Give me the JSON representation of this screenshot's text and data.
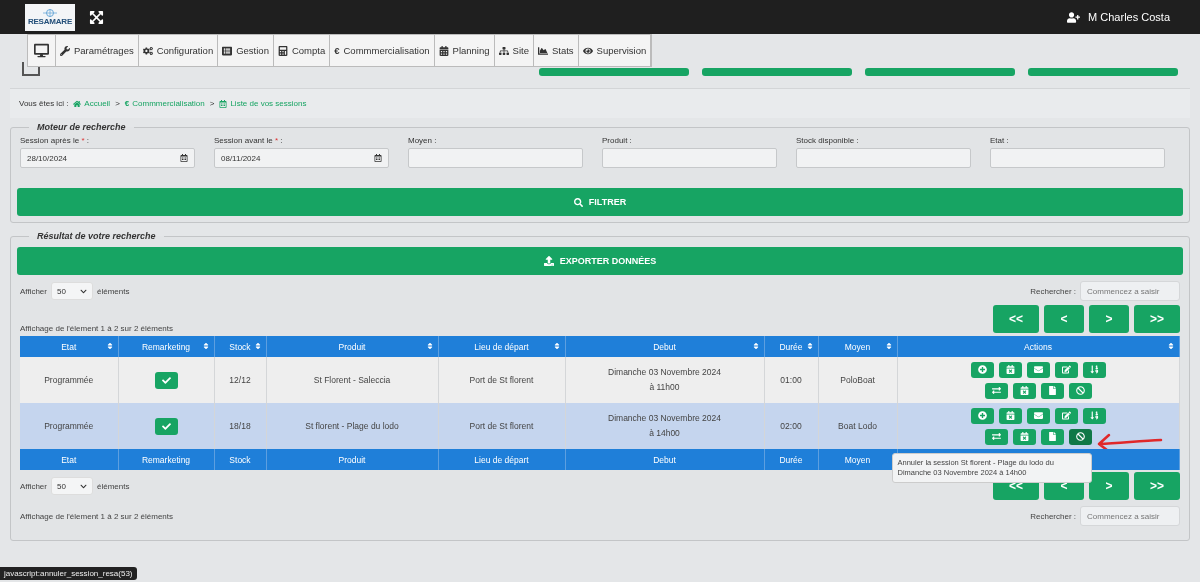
{
  "header": {
    "logo": "RESAMARE",
    "user": "M Charles Costa"
  },
  "menu": [
    {
      "label": "Paramétrages"
    },
    {
      "label": "Configuration"
    },
    {
      "label": "Gestion"
    },
    {
      "label": "Compta"
    },
    {
      "symbol": "€",
      "label": "Commmercialisation"
    },
    {
      "label": "Planning"
    },
    {
      "label": "Site"
    },
    {
      "label": "Stats"
    },
    {
      "label": "Supervision"
    }
  ],
  "breadcrumb": {
    "prefix": "Vous êtes ici :",
    "items": [
      {
        "label": "Accueil"
      },
      {
        "symbol": "€",
        "label": "Commmercialisation"
      },
      {
        "label": "Liste de vos sessions"
      }
    ],
    "separators": [
      ">",
      ">"
    ]
  },
  "search": {
    "legend": "Moteur de recherche",
    "fields": [
      {
        "label": "Session après le",
        "required_mark": "*",
        "label_end": ":",
        "kind": "date",
        "value": "28/10/2024"
      },
      {
        "label": "Session avant le",
        "required_mark": "*",
        "label_end": ":",
        "kind": "date",
        "value": "08/11/2024"
      },
      {
        "label": "Moyen :",
        "kind": "text"
      },
      {
        "label": "Produit :",
        "kind": "text"
      },
      {
        "label": "Stock disponible :",
        "kind": "text"
      },
      {
        "label": "Etat :",
        "kind": "text"
      }
    ],
    "button": "FILTRER"
  },
  "results": {
    "legend": "Résultat de votre recherche",
    "export_button": "EXPORTER DONNÉES",
    "top": {
      "length": {
        "before": "Afficher",
        "value": "50",
        "after": "éléments"
      },
      "search_label": "Rechercher :",
      "search_placeholder": "Commencez a saisir",
      "info": "Affichage de l'élement 1 à 2 sur 2 éléments",
      "pagination": [
        "<<",
        "<",
        ">",
        ">>"
      ]
    },
    "bottom": {
      "length": {
        "before": "Afficher",
        "value": "50",
        "after": "éléments"
      },
      "search_label": "Rechercher :",
      "search_placeholder": "Commencez a saisir",
      "info": "Affichage de l'élement 1 à 2 sur 2 éléments",
      "pagination": [
        "<<",
        "<",
        ">",
        ">>"
      ]
    }
  },
  "table": {
    "columns": [
      "Etat",
      "Remarketing",
      "Stock",
      "Produit",
      "Lieu de départ",
      "Debut",
      "Durée",
      "Moyen",
      "Actions"
    ],
    "rows": [
      {
        "selected": false,
        "etat": "Programmée",
        "remarketing": true,
        "stock": "12/12",
        "produit": "St Florent - Saleccia",
        "lieu": "Port de St florent",
        "debut": [
          "Dimanche 03 Novembre 2024",
          "à 11h00"
        ],
        "duree": "01:00",
        "moyen": "PoloBoat",
        "actions": [
          {
            "hovered": false
          },
          {
            "hovered": false
          },
          {
            "hovered": false
          },
          {
            "hovered": false
          },
          {
            "hovered": false
          },
          {
            "hovered": false
          },
          {
            "hovered": false
          },
          {
            "hovered": false
          },
          {
            "hovered": false
          }
        ]
      },
      {
        "selected": true,
        "etat": "Programmée",
        "remarketing": true,
        "stock": "18/18",
        "produit": "St florent - Plage du lodo",
        "lieu": "Port de St florent",
        "debut": [
          "Dimanche 03 Novembre 2024",
          "à 14h00"
        ],
        "duree": "02:00",
        "moyen": "Boat Lodo",
        "actions": [
          {
            "hovered": false
          },
          {
            "hovered": false
          },
          {
            "hovered": false
          },
          {
            "hovered": false
          },
          {
            "hovered": false
          },
          {
            "hovered": false
          },
          {
            "hovered": false
          },
          {
            "hovered": false
          },
          {
            "hovered": true
          }
        ]
      }
    ],
    "footer": [
      "Etat",
      "Remarketing",
      "Stock",
      "Produit",
      "Lieu de départ",
      "Debut",
      "Durée",
      "Moyen"
    ]
  },
  "tooltip": "Annuler la session St florent - Plage du lodo du Dimanche 03 Novembre 2024 à 14h00",
  "status_bar": "javascript:annuler_session_resa(53)"
}
